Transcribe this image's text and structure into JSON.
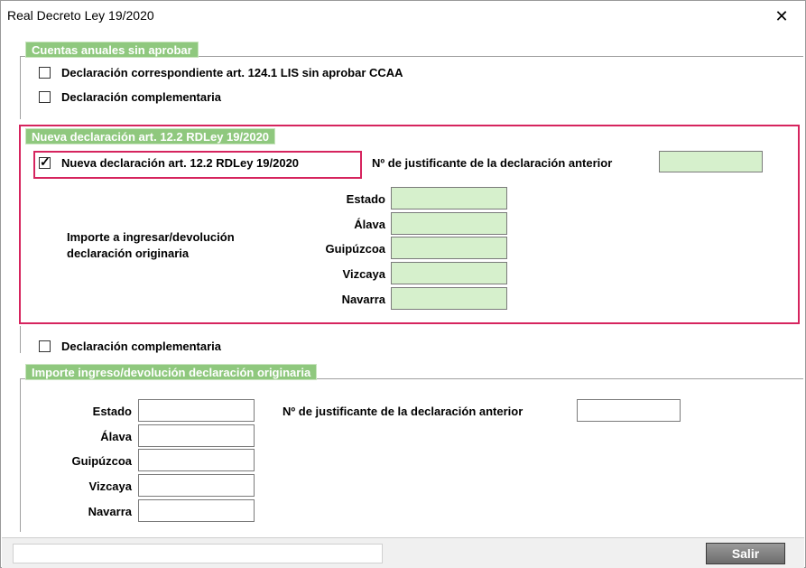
{
  "window": {
    "title": "Real Decreto Ley 19/2020",
    "close_glyph": "✕"
  },
  "section1": {
    "header": "Cuentas anuales sin aprobar",
    "check1_label": "Declaración correspondiente art. 124.1 LIS sin aprobar CCAA",
    "check1_checked": false,
    "check2_label": "Declaración complementaria",
    "check2_checked": false
  },
  "section2": {
    "header": "Nueva declaración art. 12.2 RDLey 19/2020",
    "check_label": "Nueva declaración art. 12.2 RDLey 19/2020",
    "check_checked": true,
    "justificante_label": "Nº de justificante de la declaración anterior",
    "importe_label_line1": "Importe a ingresar/devolución",
    "importe_label_line2": "declaración originaria",
    "fields": [
      "Estado",
      "Álava",
      "Guipúzcoa",
      "Vizcaya",
      "Navarra"
    ]
  },
  "complementaria": {
    "label": "Declaración complementaria",
    "checked": false
  },
  "section3": {
    "header": "Importe ingreso/devolución declaración originaria",
    "fields": [
      "Estado",
      "Álava",
      "Guipúzcoa",
      "Vizcaya",
      "Navarra"
    ],
    "justificante_label": "Nº de justificante de la declaración anterior"
  },
  "footer": {
    "exit_label": "Salir"
  },
  "colors": {
    "header_green": "#8fc87e",
    "field_green": "#d6f0cc",
    "highlight": "#d6245e"
  }
}
